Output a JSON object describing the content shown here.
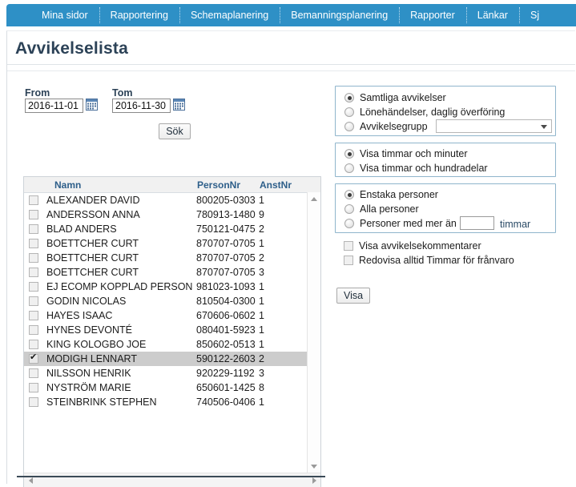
{
  "nav": {
    "items": [
      {
        "label": "Mina sidor"
      },
      {
        "label": "Rapportering"
      },
      {
        "label": "Schemaplanering"
      },
      {
        "label": "Bemanningsplanering"
      },
      {
        "label": "Rapporter"
      },
      {
        "label": "Länkar"
      },
      {
        "label": "Sj"
      }
    ]
  },
  "page": {
    "title": "Avvikelselista"
  },
  "filters": {
    "from_label": "From",
    "from_value": "2016-11-01",
    "tom_label": "Tom",
    "tom_value": "2016-11-30",
    "search_button": "Sök",
    "calendar_icon": "calendar-icon"
  },
  "list": {
    "columns": [
      "Namn",
      "PersonNr",
      "AnstNr"
    ],
    "rows": [
      {
        "checked": false,
        "selected": false,
        "namn": "ALEXANDER DAVID",
        "personnr": "800205-0303",
        "anstnr": "1"
      },
      {
        "checked": false,
        "selected": false,
        "namn": "ANDERSSON ANNA",
        "personnr": "780913-1480",
        "anstnr": "9"
      },
      {
        "checked": false,
        "selected": false,
        "namn": "BLAD ANDERS",
        "personnr": "750121-0475",
        "anstnr": "2"
      },
      {
        "checked": false,
        "selected": false,
        "namn": "BOETTCHER CURT",
        "personnr": "870707-0705",
        "anstnr": "1"
      },
      {
        "checked": false,
        "selected": false,
        "namn": "BOETTCHER CURT",
        "personnr": "870707-0705",
        "anstnr": "2"
      },
      {
        "checked": false,
        "selected": false,
        "namn": "BOETTCHER CURT",
        "personnr": "870707-0705",
        "anstnr": "3"
      },
      {
        "checked": false,
        "selected": false,
        "namn": "EJ ECOMP KOPPLAD PERSON",
        "personnr": "981023-1093",
        "anstnr": "1"
      },
      {
        "checked": false,
        "selected": false,
        "namn": "GODIN NICOLAS",
        "personnr": "810504-0300",
        "anstnr": "1"
      },
      {
        "checked": false,
        "selected": false,
        "namn": "HAYES ISAAC",
        "personnr": "670606-0602",
        "anstnr": "1"
      },
      {
        "checked": false,
        "selected": false,
        "namn": "HYNES DEVONTÉ",
        "personnr": "080401-5923",
        "anstnr": "1"
      },
      {
        "checked": false,
        "selected": false,
        "namn": "KING KOLOGBO JOE",
        "personnr": "850602-0513",
        "anstnr": "1"
      },
      {
        "checked": true,
        "selected": true,
        "namn": "MODIGH LENNART",
        "personnr": "590122-2603",
        "anstnr": "2"
      },
      {
        "checked": false,
        "selected": false,
        "namn": "NILSSON HENRIK",
        "personnr": "920229-1192",
        "anstnr": "3"
      },
      {
        "checked": false,
        "selected": false,
        "namn": "NYSTRÖM MARIE",
        "personnr": "650601-1425",
        "anstnr": "8"
      },
      {
        "checked": false,
        "selected": false,
        "namn": "STEINBRINK STEPHEN",
        "personnr": "740506-0406",
        "anstnr": "1"
      }
    ],
    "scroll_up_icon": "triangle-up-icon",
    "scroll_down_icon": "triangle-down-icon",
    "scroll_left_icon": "triangle-left-icon",
    "scroll_right_icon": "triangle-right-icon"
  },
  "options": {
    "group1": {
      "radios": [
        {
          "label": "Samtliga avvikelser",
          "selected": true
        },
        {
          "label": "Lönehändelser, daglig överföring",
          "selected": false
        },
        {
          "label": "Avvikelsegrupp",
          "selected": false
        }
      ],
      "dropdown_value": "",
      "dropdown_icon": "chevron-down-icon"
    },
    "group2": {
      "radios": [
        {
          "label": "Visa timmar och minuter",
          "selected": true
        },
        {
          "label": "Visa timmar och hundradelar",
          "selected": false
        }
      ]
    },
    "group3": {
      "radios": [
        {
          "label": "Enstaka personer",
          "selected": true
        },
        {
          "label": "Alla personer",
          "selected": false
        },
        {
          "label": "Personer med mer än",
          "selected": false
        }
      ],
      "hours_value": "",
      "hours_suffix": "timmar"
    },
    "checkboxes": [
      {
        "label": "Visa avvikelsekommentarer",
        "checked": false
      },
      {
        "label": "Redovisa alltid Timmar för frånvaro",
        "checked": false
      }
    ],
    "show_button": "Visa"
  },
  "colors": {
    "nav_blue": "#2e90c6",
    "title_dark": "#2c4257",
    "selected_row": "#cccccc",
    "group_border": "#8fb5cc"
  }
}
